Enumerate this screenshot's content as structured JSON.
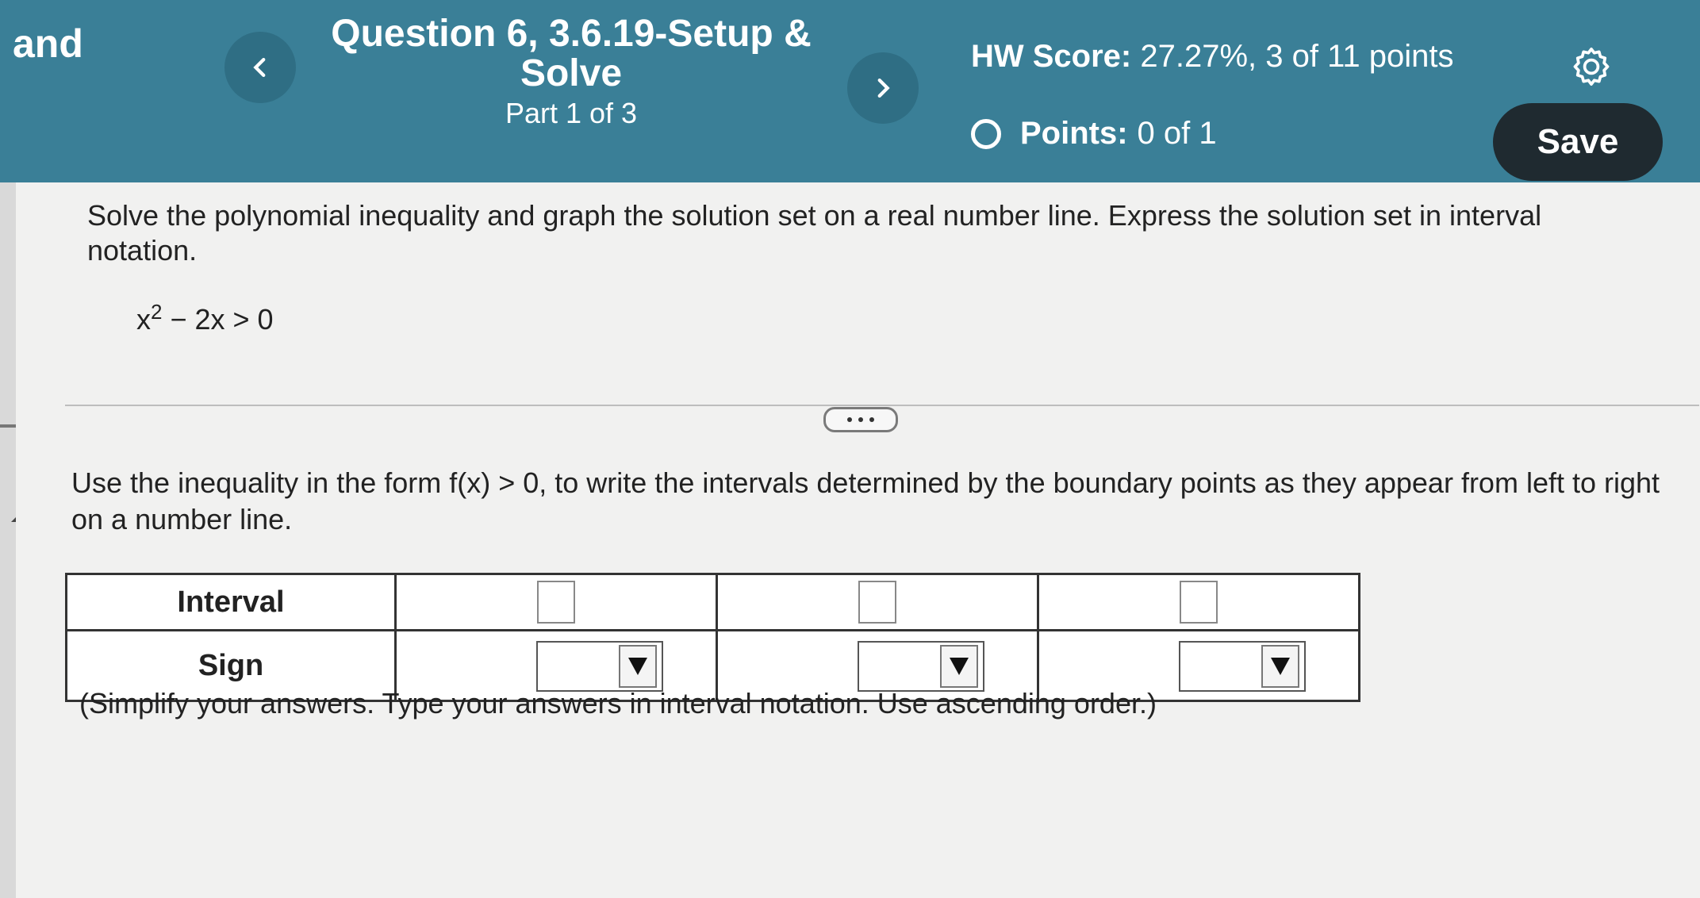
{
  "header": {
    "course_fragment": "and",
    "question_title": "Question 6, 3.6.19-Setup & Solve",
    "part": "Part 1 of 3",
    "hw_score_label": "HW Score:",
    "hw_score_value": "27.27%, 3 of 11 points",
    "points_label": "Points:",
    "points_value": "0 of 1",
    "save_label": "Save",
    "icons": {
      "prev": "chevron-left-icon",
      "next": "chevron-right-icon",
      "settings": "gear-icon",
      "status": "circle-icon"
    }
  },
  "question": {
    "prompt": "Solve the polynomial inequality and graph the solution set on a real number line. Express the solution set in interval notation.",
    "equation_base": "x",
    "equation_exp": "2",
    "equation_rest": " − 2x > 0",
    "instruction": "Use the inequality in the form f(x) > 0, to write the intervals determined by the boundary points as they appear from left to right on a number line.",
    "table": {
      "row_labels": [
        "Interval",
        "Sign"
      ],
      "interval_values": [
        "",
        "",
        ""
      ],
      "sign_values": [
        "",
        "",
        ""
      ]
    },
    "note": "(Simplify your answers. Type your answers in interval notation. Use ascending order.)"
  }
}
